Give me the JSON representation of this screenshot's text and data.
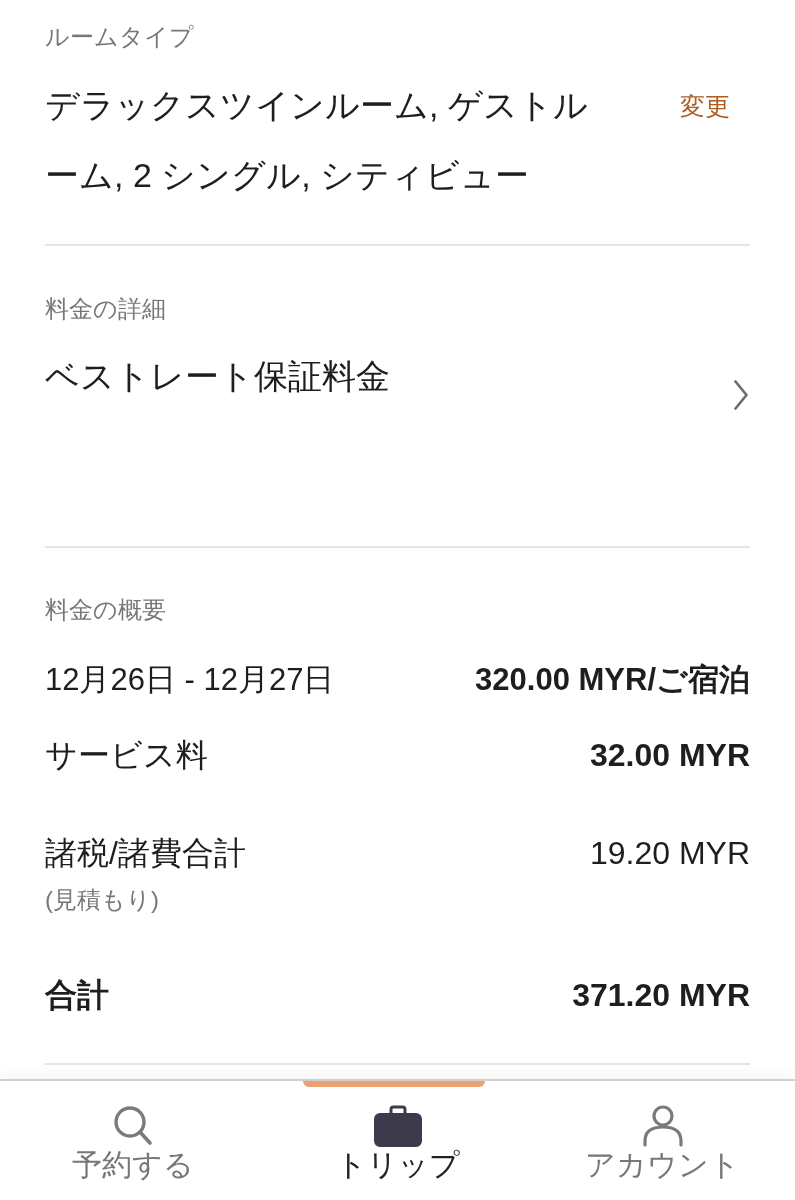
{
  "room_type": {
    "label": "ルームタイプ",
    "value": "デラックスツインルーム, ゲストルーム, 2 シングル, シティビュー",
    "change_link": "変更"
  },
  "rate_details": {
    "label": "料金の詳細",
    "value": "ベストレート保証料金"
  },
  "price_summary": {
    "label": "料金の概要",
    "rows": [
      {
        "label": "12月26日 - 12月27日",
        "amount": "320.00 MYR/ご宿泊",
        "emphasized": true
      },
      {
        "label": "サービス料",
        "amount": "32.00 MYR",
        "emphasized": true
      },
      {
        "label": "諸税/諸費合計",
        "note": "(見積もり)",
        "amount": "19.20 MYR",
        "emphasized": false
      }
    ],
    "total": {
      "label": "合計",
      "amount": "371.20 MYR"
    }
  },
  "bottom_nav": [
    {
      "label": "予約する",
      "selected": false
    },
    {
      "label": "トリップ",
      "selected": true
    },
    {
      "label": "アカウント",
      "selected": false
    }
  ]
}
